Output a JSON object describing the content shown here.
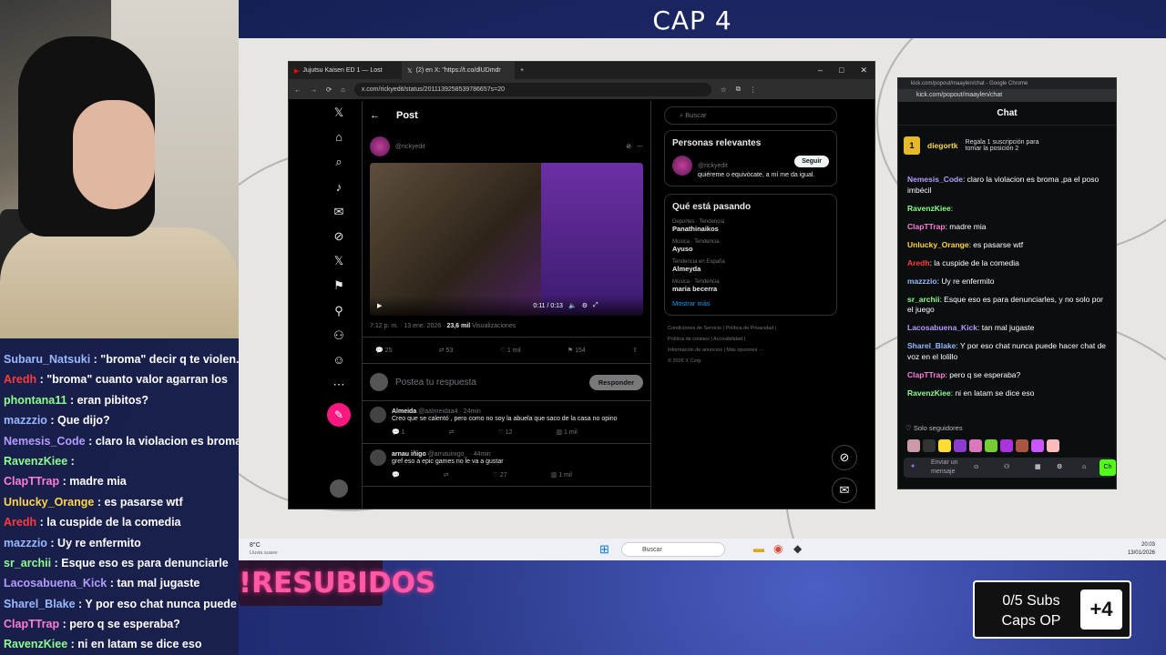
{
  "overlay": {
    "title": "CAP 4",
    "resubidos": "!RESUBIDOS",
    "subs_line1": "0/5 Subs",
    "subs_line2": "Caps OP",
    "subs_plus": "+4"
  },
  "stream_chat": [
    {
      "name": "Subaru_Natsuki",
      "text": " : \"broma\" decir q te violen...",
      "color": "#9ab8ff"
    },
    {
      "name": "Aredh",
      "text": " : \"broma\" cuanto valor agarran los",
      "color": "#ff3b3b"
    },
    {
      "name": "phontana11",
      "text": " : eran pibitos?",
      "color": "#8cff8c"
    },
    {
      "name": "mazzzio",
      "text": " : Que dijo?",
      "color": "#9ab8ff"
    },
    {
      "name": "Nemesis_Code",
      "text": " : claro la violacion es broma ,",
      "color": "#b49cff"
    },
    {
      "name": "RavenzKiee",
      "text": " : ",
      "color": "#8cff8c"
    },
    {
      "name": "ClapTTrap",
      "text": " : madre mia",
      "color": "#ff7dd6"
    },
    {
      "name": "Unlucky_Orange",
      "text": " : es pasarse wtf",
      "color": "#ffd54a"
    },
    {
      "name": "Aredh",
      "text": " : la cuspide de la comedia",
      "color": "#ff3b3b"
    },
    {
      "name": "mazzzio",
      "text": " : Uy re enfermito",
      "color": "#9ab8ff"
    },
    {
      "name": "sr_archii",
      "text": " : Esque eso es para denunciarle",
      "color": "#8cff8c"
    },
    {
      "name": "Lacosabuena_Kick",
      "text": " : tan mal jugaste",
      "color": "#b49cff"
    },
    {
      "name": "Sharel_Blake",
      "text": " : Y por eso chat nunca puede ha",
      "color": "#9ab8ff"
    },
    {
      "name": "ClapTTrap",
      "text": " : pero q se esperaba?",
      "color": "#ff7dd6"
    },
    {
      "name": "RavenzKiee",
      "text": " : ni en latam se dice eso",
      "color": "#8cff8c"
    }
  ],
  "browser": {
    "tab1": "Jujutsu Kaisen ED 1 — Lost",
    "tab2": "(2) en X: \"https://t.co/dlUDmdr",
    "url": "x.com/rickyedit/status/2011139258539786657s=20"
  },
  "x": {
    "header": "Post",
    "author_handle": "@rickyedit",
    "video_time": "0:11 / 0:13",
    "meta_time": "7:12 p. m. · 13 ene. 2026 · ",
    "meta_views": "23,6 mil",
    "meta_views_label": " Visualizaciones",
    "stats": {
      "replies": "25",
      "reposts": "53",
      "likes": "1 mil",
      "bookmarks": "154"
    },
    "reply_placeholder": "Postea tu respuesta",
    "reply_button": "Responder",
    "replies": [
      {
        "name": "Almeida",
        "handle": "@aalmeidaa4 · 24min",
        "text": "Creo que se calentó , pero como no soy la abuela que saco de la casa no opino",
        "r": "1",
        "l": "12",
        "v": "1 mil"
      },
      {
        "name": "arnau iñigo",
        "handle": "@arnauinigo_ · 44min",
        "text": "gref eso a epic games no le va a gustar",
        "r": "",
        "l": "27",
        "v": "1 mil"
      }
    ],
    "search_placeholder": "Buscar",
    "relevant_title": "Personas relevantes",
    "relevant_handle": "@rickyedit",
    "relevant_bio": "quiéreme o equivócate, a mí me da igual.",
    "follow_label": "Seguir",
    "happening_title": "Qué está pasando",
    "trends": [
      {
        "cat": "Deportes · Tendencia",
        "name": "Panathinaikos"
      },
      {
        "cat": "Música · Tendencia",
        "name": "Ayuso"
      },
      {
        "cat": "Tendencia en España",
        "name": "Almeyda"
      },
      {
        "cat": "Música · Tendencia",
        "name": "maria becerra"
      }
    ],
    "show_more": "Mostrar más",
    "footer1": "Condiciones de Servicio  |  Política de Privacidad  |",
    "footer2": "Política de cookies  |  Accesibilidad  |",
    "footer3": "Información de anuncios  |  Más opciones ···",
    "footer4": "© 2026 X Corp."
  },
  "kick": {
    "window_title": "kick.com/popout/maaylen/chat - Google Chrome",
    "url": "kick.com/popout/maaylen/chat",
    "title": "Chat",
    "pinned_user": "diegortk",
    "pinned_rank": "1",
    "pinned_text": "Regala 1 suscripción para tomar la posición 2",
    "messages": [
      {
        "name": "Nemesis_Code",
        "text": ": claro la violacion es broma ,pa el poso imbécil",
        "color": "#b49cff"
      },
      {
        "name": "RavenzKiee",
        "text": ": ",
        "color": "#8cff8c"
      },
      {
        "name": "ClapTTrap",
        "text": ": madre mia",
        "color": "#ff7dd6"
      },
      {
        "name": "Unlucky_Orange",
        "text": ": es pasarse wtf",
        "color": "#ffd54a"
      },
      {
        "name": "Aredh",
        "text": ": la cuspide de la comedia",
        "color": "#ff3b3b"
      },
      {
        "name": "mazzzio",
        "text": ": Uy re enfermito",
        "color": "#9ab8ff"
      },
      {
        "name": "sr_archii",
        "text": ": Esque eso es para denunciarles, y no solo por el juego",
        "color": "#8cff8c"
      },
      {
        "name": "Lacosabuena_Kick",
        "text": ": tan mal jugaste",
        "color": "#b49cff"
      },
      {
        "name": "Sharel_Blake",
        "text": ": Y por eso chat nunca puede hacer chat de voz en el lolillo",
        "color": "#9ab8ff"
      },
      {
        "name": "ClapTTrap",
        "text": ": pero q se esperaba?",
        "color": "#ff7dd6"
      },
      {
        "name": "RavenzKiee",
        "text": ": ni en latam se dice eso",
        "color": "#8cff8c"
      }
    ],
    "followers_only": "Solo seguidores",
    "input_placeholder": "Enviar un mensaje",
    "send_label": "Ch"
  },
  "taskbar": {
    "weather_temp": "8°C",
    "weather_desc": "Lluvia suave",
    "search": "Buscar",
    "time": "20:03",
    "date": "13/01/2026"
  }
}
